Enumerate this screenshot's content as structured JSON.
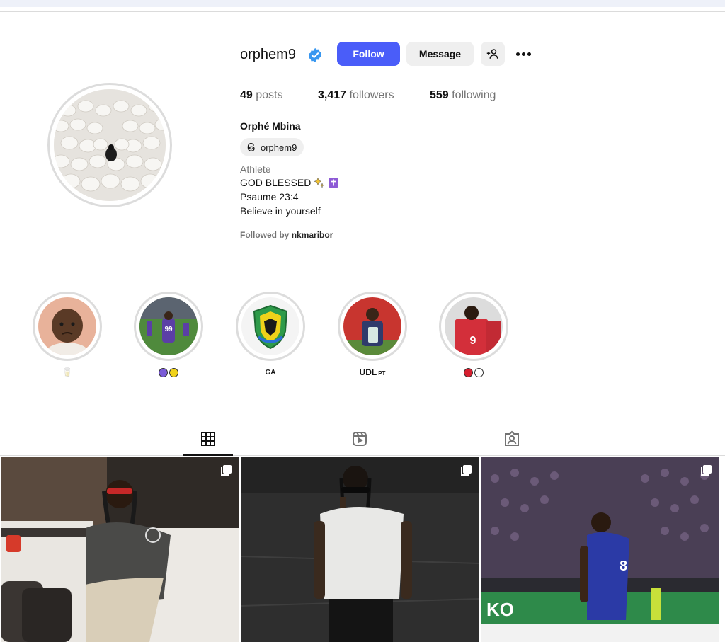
{
  "profile": {
    "username": "orphem9",
    "full_name": "Orphé Mbina",
    "threads_handle": "orphem9",
    "category": "Athlete",
    "bio_lines": [
      "GOD BLESSED",
      "Psaume 23:4",
      "Believe in yourself"
    ],
    "followed_by_prefix": "Followed by",
    "followed_by_user": "nkmaribor"
  },
  "actions": {
    "follow_label": "Follow",
    "message_label": "Message"
  },
  "stats": {
    "posts_count": "49",
    "posts_label": "posts",
    "followers_count": "3,417",
    "followers_label": "followers",
    "following_count": "559",
    "following_label": "following"
  },
  "highlights": [
    {
      "label": "🥛"
    },
    {
      "label": ""
    },
    {
      "label": "GA"
    },
    {
      "label": "UDL",
      "suffix": "PT"
    },
    {
      "label": ""
    }
  ],
  "tabs": [
    "grid-icon",
    "reels-icon",
    "tagged-icon"
  ],
  "colors": {
    "accent": "#4a5df9",
    "verified": "#3897f0",
    "text": "#262626",
    "muted": "#737373",
    "button_bg": "#efefef"
  }
}
